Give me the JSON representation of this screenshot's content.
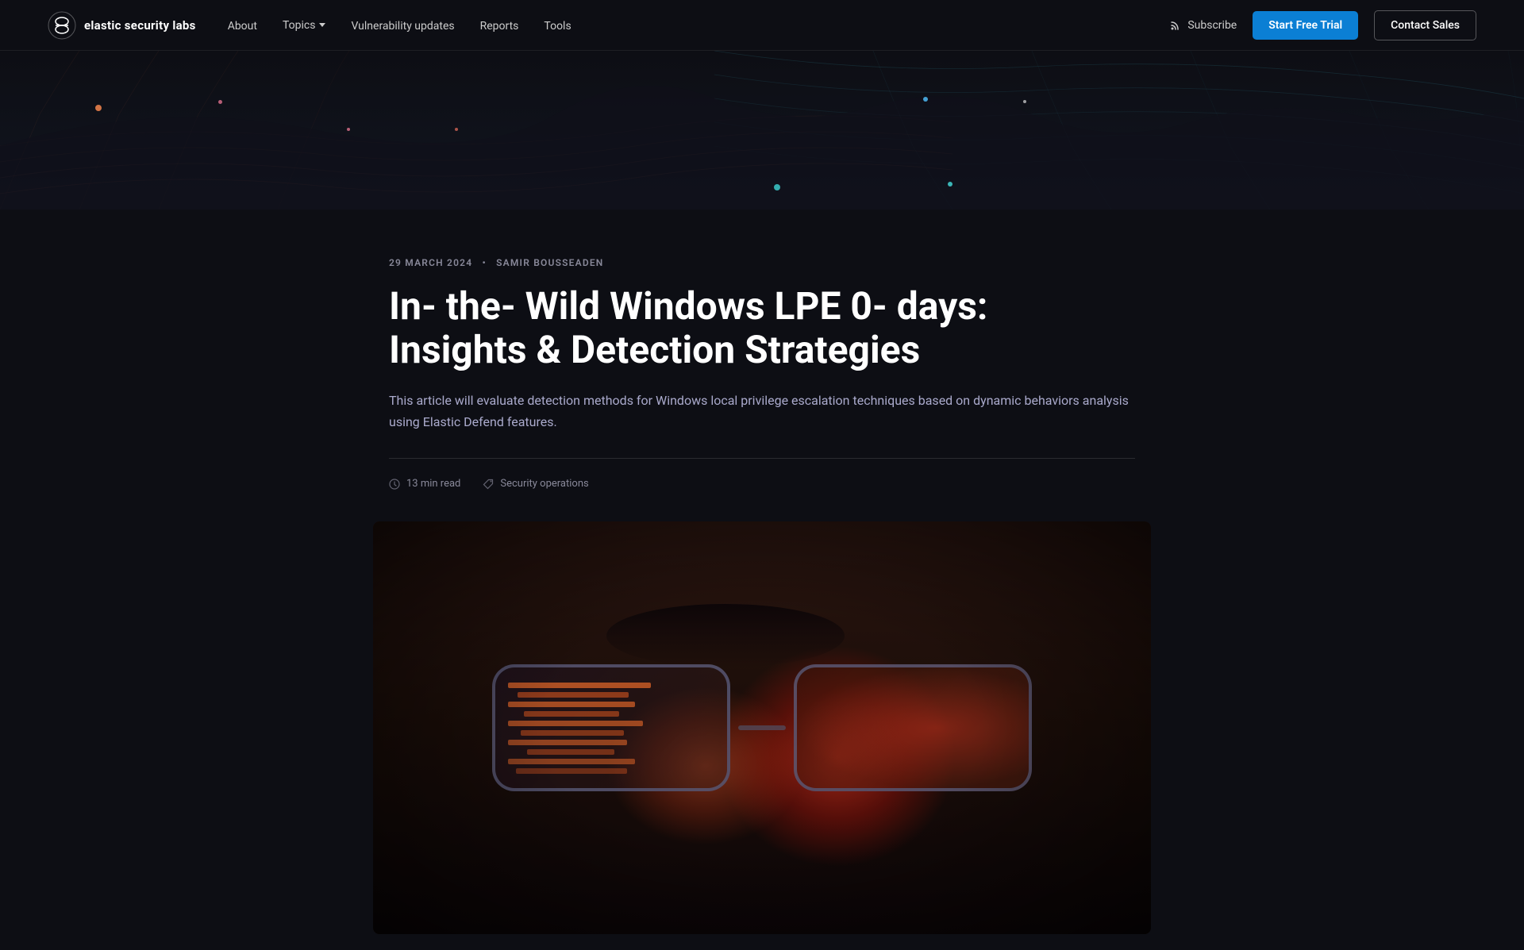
{
  "brand": {
    "logo_text_normal": "elastic",
    "logo_text_bold": " security labs",
    "logo_alt": "Elastic Security Labs"
  },
  "nav": {
    "about_label": "About",
    "topics_label": "Topics",
    "vulnerability_updates_label": "Vulnerability updates",
    "reports_label": "Reports",
    "tools_label": "Tools",
    "subscribe_label": "Subscribe",
    "start_trial_label": "Start Free Trial",
    "contact_sales_label": "Contact Sales"
  },
  "article": {
    "date": "29 MARCH 2024",
    "separator": "•",
    "author": "SAMIR BOUSSEADEN",
    "title": "In‑ the‑ Wild Windows LPE 0‑ days: Insights & Detection Strategies",
    "description": "This article will evaluate detection methods for Windows local privilege escalation techniques based on dynamic behaviors analysis using Elastic Defend features.",
    "read_time": "13 min read",
    "tag": "Security operations",
    "image_alt": "Close-up of glasses reflecting red-tinted code on a screen"
  },
  "colors": {
    "bg": "#0d0e14",
    "nav_border": "rgba(255,255,255,0.07)",
    "accent_blue": "#0b7fd4",
    "text_primary": "#ffffff",
    "text_secondary": "#aaaacc",
    "text_muted": "#888899"
  }
}
